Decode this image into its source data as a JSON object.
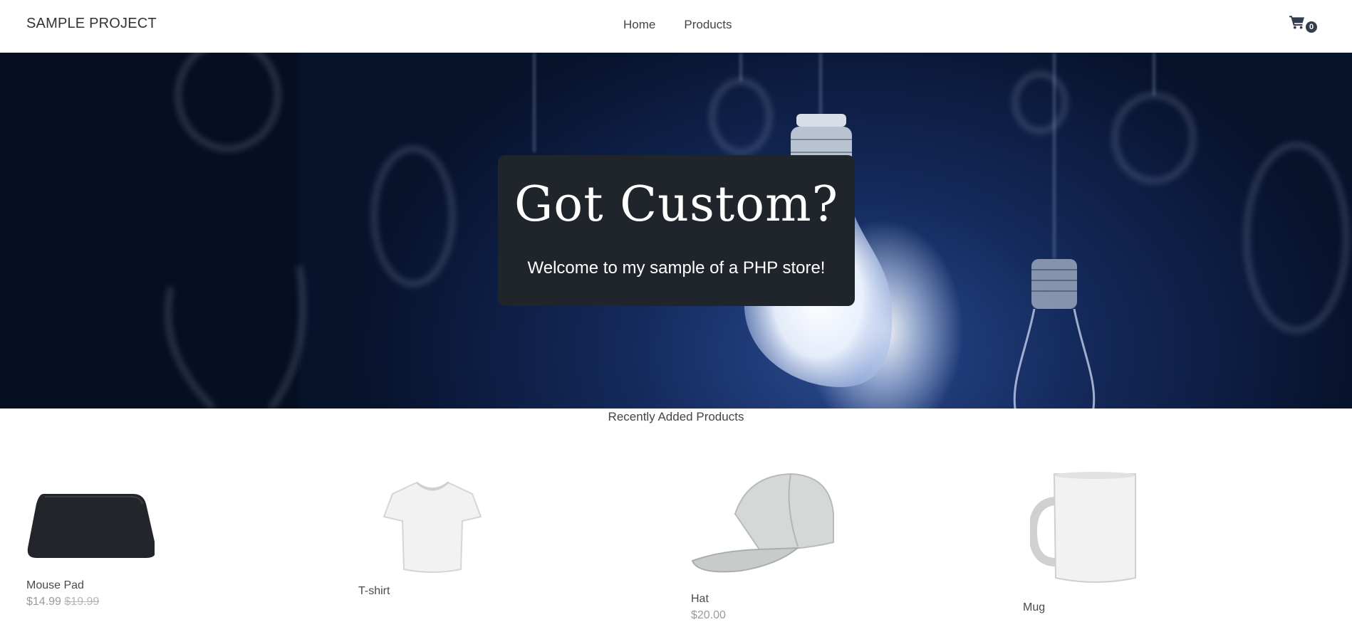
{
  "header": {
    "brand": "SAMPLE PROJECT",
    "nav": [
      {
        "label": "Home"
      },
      {
        "label": "Products"
      }
    ],
    "cart_count": "0",
    "cart_icon": "shopping-cart-icon"
  },
  "hero": {
    "title": "Got Custom?",
    "subtitle": "Welcome to my sample of a PHP store!"
  },
  "recent": {
    "title": "Recently Added Products",
    "products": [
      {
        "name": "Mouse Pad",
        "price": "$14.99",
        "rrp": "$19.99"
      },
      {
        "name": "T-shirt",
        "price": "",
        "rrp": ""
      },
      {
        "name": "Hat",
        "price": "$20.00",
        "rrp": ""
      },
      {
        "name": "Mug",
        "price": "",
        "rrp": ""
      }
    ]
  },
  "colors": {
    "hero_card": "#20242b",
    "text": "#4a4a4a",
    "badge": "#333d4d"
  }
}
